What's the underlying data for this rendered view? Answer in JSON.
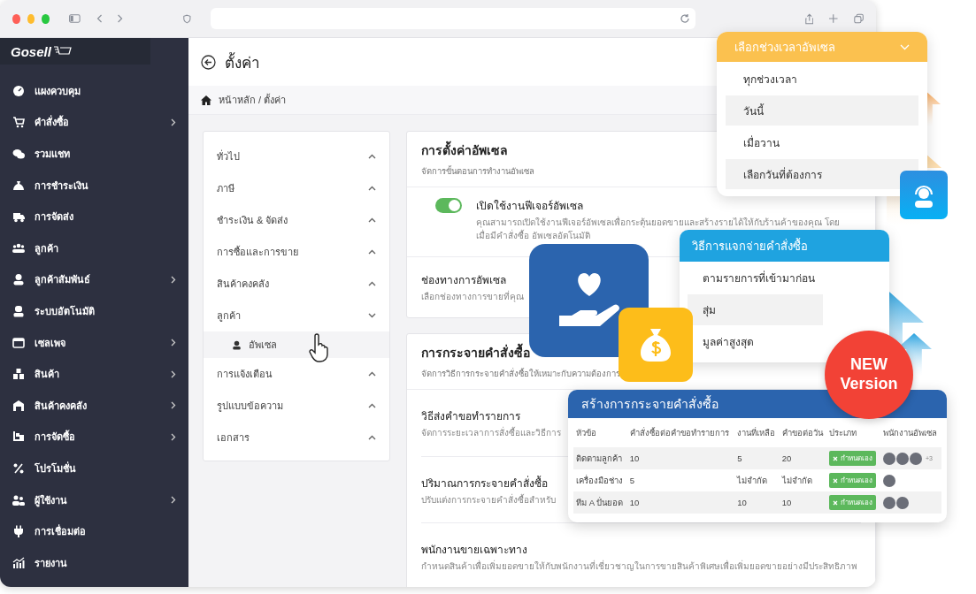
{
  "logo": {
    "text": "Gosell"
  },
  "sidebar": {
    "items": [
      {
        "label": "แผงควบคุม",
        "has_submenu": false
      },
      {
        "label": "คำสั่งซื้อ",
        "has_submenu": true
      },
      {
        "label": "รวมแชท",
        "has_submenu": false
      },
      {
        "label": "การชำระเงิน",
        "has_submenu": false
      },
      {
        "label": "การจัดส่ง",
        "has_submenu": false
      },
      {
        "label": "ลูกค้า",
        "has_submenu": false
      },
      {
        "label": "ลูกค้าสัมพันธ์",
        "has_submenu": true
      },
      {
        "label": "ระบบอัตโนมัติ",
        "has_submenu": false
      },
      {
        "label": "เซลเพจ",
        "has_submenu": true
      },
      {
        "label": "สินค้า",
        "has_submenu": true
      },
      {
        "label": "สินค้าคงคลัง",
        "has_submenu": true
      },
      {
        "label": "การจัดซื้อ",
        "has_submenu": true
      },
      {
        "label": "โปรโมชั่น",
        "has_submenu": false
      },
      {
        "label": "ผู้ใช้งาน",
        "has_submenu": true
      },
      {
        "label": "การเชื่อมต่อ",
        "has_submenu": false
      },
      {
        "label": "รายงาน",
        "has_submenu": false
      }
    ]
  },
  "page": {
    "title": "ตั้งค่า",
    "breadcrumb": "หน้าหลัก / ตั้งค่า"
  },
  "settings_nav": [
    {
      "label": "ทั่วไป",
      "expanded": false
    },
    {
      "label": "ภาษี",
      "expanded": false
    },
    {
      "label": "ชำระเงิน & จัดส่ง",
      "expanded": false
    },
    {
      "label": "การซื้อและการขาย",
      "expanded": false
    },
    {
      "label": "สินค้าคงคลัง",
      "expanded": false
    },
    {
      "label": "ลูกค้า",
      "expanded": true,
      "children": [
        {
          "label": "อัพเซล",
          "selected": true
        }
      ]
    },
    {
      "label": "การแจ้งเตือน",
      "expanded": false
    },
    {
      "label": "รูปแบบข้อความ",
      "expanded": false
    },
    {
      "label": "เอกสาร",
      "expanded": false
    }
  ],
  "upsell_settings": {
    "title": "การตั้งค่าอัพเซล",
    "subtitle": "จัดการขั้นตอนการทำงานอัพเซล",
    "feature": {
      "title": "เปิดใช้งานฟีเจอร์อัพเซล",
      "description": "คุณสามารถเปิดใช้งานฟีเจอร์อัพเซลเพื่อกระตุ้นยอดขายและสร้างรายได้ให้กับร้านค้าของคุณ โดยเมื่อมีคำสั่งซื้อ อัพเซลอัตโนมัติ",
      "on": true
    },
    "channel": {
      "title": "ช่องทางการอัพเซล",
      "description": "เลือกช่องทางการขายที่คุณ"
    }
  },
  "order_distribution": {
    "title": "การกระจายคำสั่งซื้อ",
    "subtitle": "จัดการวิธีการกระจายคำสั่งซื้อให้เหมาะกับความต้องการ",
    "items": [
      {
        "title": "วิธีส่งคำขอทำรายการ",
        "description": "จัดการระยะเวลาการสั่งซื้อและวิธีการ"
      },
      {
        "title": "ปริมาณการกระจายคำสั่งซื้อ",
        "description": "ปรับแต่งการกระจายคำสั่งซื้อสำหรับ"
      },
      {
        "title": "พนักงานขายเฉพาะทาง",
        "description": "กำหนดสินค้าเพื่อเพิ่มยอดขายให้กับพนักงานที่เชี่ยวชาญในการขายสินค้าพิเศษเพื่อเพิ่มยอดขายอย่างมีประสิทธิภาพ"
      }
    ]
  },
  "time_range_dropdown": {
    "title": "เลือกช่วงเวลาอัพเซล",
    "options": [
      {
        "label": "ทุกช่วงเวลา",
        "selected": false
      },
      {
        "label": "วันนี้",
        "selected": true
      },
      {
        "label": "เมื่อวาน",
        "selected": false
      },
      {
        "label": "เลือกวันที่ต้องการ",
        "selected": true
      }
    ]
  },
  "distribution_method": {
    "title": "วิธีการแจกจ่ายคำสั่งซื้อ",
    "options": [
      {
        "label": "ตามรายการที่เข้ามาก่อน",
        "selected": false
      },
      {
        "label": "สุ่ม",
        "selected": true
      },
      {
        "label": "มูลค่าสูงสุด",
        "selected": false
      }
    ]
  },
  "new_badge": {
    "lines": [
      "NEW",
      "Version"
    ]
  },
  "distribution_table": {
    "title": "สร้างการกระจายคำสั่งซื้อ",
    "columns": [
      "หัวข้อ",
      "คำสั่งซื้อต่อคำขอทำรายการ",
      "งานที่เหลือ",
      "คำขอต่อวัน",
      "ประเภท",
      "พนักงานอัพเซล"
    ],
    "rows": [
      {
        "cells": [
          "ติดตามลูกค้า",
          "10",
          "5",
          "20"
        ],
        "type": "กำหนดเอง",
        "staff": [
          {
            "kind": "photo"
          },
          {
            "kind": "photo"
          },
          {
            "kind": "photo"
          }
        ],
        "more": "+3"
      },
      {
        "cells": [
          "เครื่องมือช่าง",
          "5",
          "ไม่จำกัด",
          "ไม่จำกัด"
        ],
        "type": "กำหนดเอง",
        "staff": [
          {
            "kind": "photo"
          }
        ]
      },
      {
        "cells": [
          "ทีม A ปั่นยอด",
          "10",
          "10",
          "10"
        ],
        "type": "กำหนดเอง",
        "staff": [
          {
            "kind": "photo"
          },
          {
            "kind": "photo"
          }
        ]
      }
    ]
  }
}
